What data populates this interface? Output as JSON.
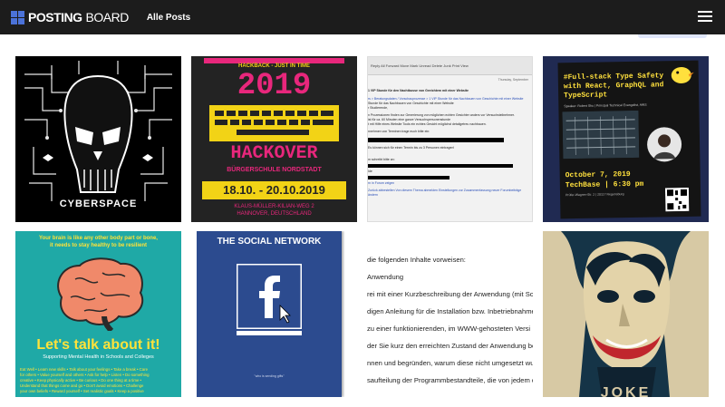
{
  "navbar": {
    "brand_part1": "POSTING",
    "brand_part2": "BOARD",
    "nav_link": "Alle Posts"
  },
  "posts": {
    "cyberspace": {
      "caption": "CYBERSPACE"
    },
    "hackover": {
      "header": "HACKBACK - JUST IN TIME",
      "year": "2019",
      "title": "HACKOVER",
      "venue": "BÜRGERSCHULE NORDSTADT",
      "dates": "18.10. - 20.10.2019",
      "address_line1": "KLAUS-MÜLLER-KILIAN-WEG 2",
      "address_line2": "HANNOVER, DEUTSCHLAND"
    },
    "email": {
      "toolbar": "Reply  All  Forward  Move  Mark Unread  Delete  Junk  Print View",
      "date": "Thursday, September",
      "lines": [
        "1 VIP Stunde für den Nachtbusse von Geeichtem mit einer Website",
        "rs > Beratungsdaten / Vorschauprozesse > 1 VIP Stunde für das Nachbauen von Geschichte mit einer Website",
        "Stunde für das Nachbauen von Geschichte mit einer Website",
        "r Studierende,",
        "n Prozessionen finden zur Generierung von möglichen echten Gesichter anders vor Versuchsteilnehmer.",
        "ist für ca. 60 Minuten eine ganze Versuchspersonenstunde",
        "t mit Hilfe eines Website Tools ein echtes Gesicht möglichst detailgetreu nachbauen.",
        "nnehmen von Terminen trage euch bitte ein:",
        "Es können sich für einen Termin bis zu 3 Personen eintragen!",
        "m schreibt bitte an:",
        "Ide",
        "rn in Forum zeigen",
        "Zurück abbestellen  Von diesem Thema abmelden  Einstellungen zur Zusammenfassung neuer Forumbeiträge ändern"
      ]
    },
    "techbase": {
      "title_line1": "#Full-stack Type Safety",
      "title_line2": "with React, GraphQL and",
      "title_line3": "TypeScript",
      "speaker": "Speaker: Robert Shu | Principal Technical Evangelist, AWS",
      "date": "October 7, 2019",
      "time_line": "TechBase | 6:30 pm",
      "address": "Prüfer-Wagner-Str. 2 | 20117 Regensburg"
    },
    "brain": {
      "line1": "Your brain is like any other body part or bone,",
      "line2": "it needs to stay healthy to be resilient",
      "headline": "Let's talk about it!",
      "subline": "Supporting Mental Health in Schools and Colleges",
      "tips": [
        "Eat Well • Learn new skills • Talk about your feelings • Take a break • Care",
        "for others • Value yourself and others • Ask for help • Listen • Do something",
        "creative • Keep physically active • Be curious • Do one thing at a time •",
        "Understand that things come and go • Don't avoid emotions • Challenge",
        "your own beliefs • Reward yourself • Set realistic goals • Keep a positive"
      ]
    },
    "social": {
      "title": "THE SOCIAL NETWORK",
      "tagline": "\"who is sending gifts\""
    },
    "document": {
      "lines": [
        "die folgenden Inhalte vorweisen:",
        "Anwendung",
        "rei mit einer Kurzbeschreibung der Anwendung (mit Scree",
        "digen Anleitung für die Installation bzw. Inbetriebnahme",
        "zu einer funktionierenden, im WWW-gehosteten Versi",
        "der Sie kurz den erreichten Zustand der Anwendung besc",
        "nnen und begründen, warum diese nicht umgesetzt wur",
        "saufteilung der Programmbestandteile, die von jedem de"
      ]
    },
    "joker": {
      "caption": "JOKE"
    }
  },
  "colors": {
    "navbar": "#1c1c1c",
    "brand_blue": "#4b72d8",
    "hack_yellow": "#f2d316",
    "hack_pink": "#e8277c",
    "teal": "#1fa9a6",
    "facebook_blue": "#2c4b8f",
    "tech_yellow": "#ffe03d"
  }
}
